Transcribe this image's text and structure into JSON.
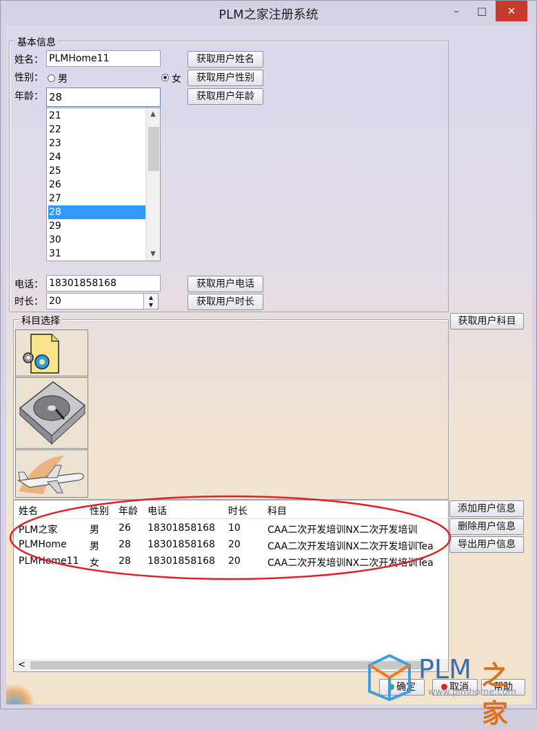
{
  "window": {
    "title": "PLM之家注册系统",
    "minimize": "–",
    "maximize": "□",
    "close": "✕"
  },
  "basic": {
    "legend": "基本信息",
    "name_label": "姓名：",
    "name_value": "PLMHome11",
    "gender_label": "性别：",
    "male_label": "男",
    "female_label": "女",
    "gender_selected": "女",
    "age_label": "年龄：",
    "age_value": "28",
    "age_options": [
      "21",
      "22",
      "23",
      "24",
      "25",
      "26",
      "27",
      "28",
      "29",
      "30",
      "31"
    ],
    "age_selected": "28",
    "phone_label": "电话：",
    "phone_value": "18301858168",
    "duration_label": "时长：",
    "duration_value": "20",
    "btn_get_name": "获取用户姓名",
    "btn_get_gender": "获取用户性别",
    "btn_get_age": "获取用户年龄",
    "btn_get_phone": "获取用户电话",
    "btn_get_duration": "获取用户时长"
  },
  "subjects": {
    "legend": "科目选择",
    "btn_get_subject": "获取用户科目",
    "icons": [
      "gear-document-icon",
      "hard-disk-icon",
      "airplane-icon"
    ]
  },
  "table": {
    "columns": [
      "姓名",
      "性别",
      "年龄",
      "电话",
      "时长",
      "科目"
    ],
    "rows": [
      [
        "PLM之家",
        "男",
        "26",
        "18301858168",
        "10",
        "CAA二次开发培训NX二次开发培训"
      ],
      [
        "PLMHome",
        "男",
        "28",
        "18301858168",
        "20",
        "CAA二次开发培训NX二次开发培训Tea"
      ],
      [
        "PLMHome11",
        "女",
        "28",
        "18301858168",
        "20",
        "CAA二次开发培训NX二次开发培训Tea"
      ]
    ],
    "btn_add": "添加用户信息",
    "btn_delete": "删除用户信息",
    "btn_export": "导出用户信息",
    "scroll_left": "<"
  },
  "footer": {
    "btn_ok": "确定",
    "btn_cancel": "取消",
    "btn_help": "帮助"
  },
  "watermark": {
    "text_plm": "PLM",
    "text_home": "之家",
    "url": "www.plmhome.com"
  },
  "colors": {
    "selection": "#3399ff",
    "annotation": "#e02020",
    "close": "#c73a2e"
  }
}
